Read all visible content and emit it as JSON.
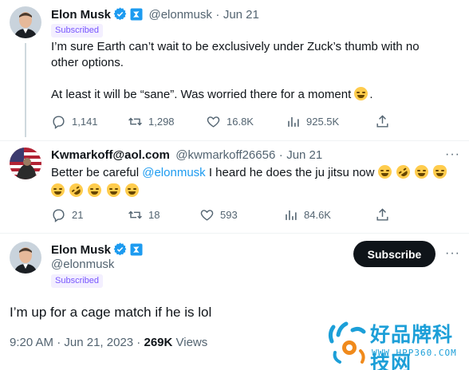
{
  "tweet1": {
    "name": "Elon Musk",
    "handle": "@elonmusk",
    "dot": "·",
    "date": "Jun 21",
    "subscribed": "Subscribed",
    "line1": "I’m sure Earth can’t wait to be exclusively under Zuck’s thumb with no",
    "line2": "other options.",
    "line3": "At least it will be “sane”. Was worried there for a moment",
    "line3_end": ".",
    "replies": "1,141",
    "retweets": "1,298",
    "likes": "16.8K",
    "views": "925.5K"
  },
  "tweet2": {
    "name": "Kwmarkoff@aol.com",
    "handle": "@kwmarkoff26656",
    "dot": "·",
    "date": "Jun 21",
    "text_before": "Better be careful ",
    "mention": "@elonmusk",
    "text_after": " I heard he does the ju jitsu now",
    "more": "···",
    "replies": "21",
    "retweets": "18",
    "likes": "593",
    "views": "84.6K"
  },
  "tweet3": {
    "name": "Elon Musk",
    "handle": "@elonmusk",
    "subscribed": "Subscribed",
    "subscribe_button": "Subscribe",
    "more": "···",
    "text": "I’m up for a cage match if he is lol",
    "time": "9:20 AM",
    "sep": " · ",
    "date": "Jun 21, 2023",
    "views_count": "269K",
    "views_label": " Views"
  },
  "watermark": {
    "cn": "好品牌科技网",
    "url": "WWW.HPP360.COM"
  },
  "colors": {
    "verified": "#1d9bf0",
    "link": "#1d9bf0",
    "subscribed_text": "#7856ff",
    "muted": "#536471",
    "watermark": "#1c9fd8"
  }
}
